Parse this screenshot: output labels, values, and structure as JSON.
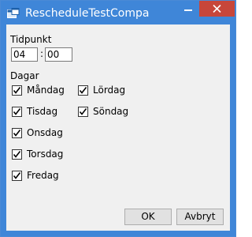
{
  "window": {
    "title": "RescheduleTestCompa",
    "icon": "app-window-icon",
    "colors": {
      "titlebar": "#3f86d8",
      "close": "#c7463a",
      "client": "#f0f0f0"
    }
  },
  "form": {
    "time_label": "Tidpunkt",
    "hour": "04",
    "separator": ":",
    "minute": "00",
    "days_label": "Dagar",
    "days": [
      {
        "label": "Måndag",
        "checked": true
      },
      {
        "label": "Tisdag",
        "checked": true
      },
      {
        "label": "Onsdag",
        "checked": true
      },
      {
        "label": "Torsdag",
        "checked": true
      },
      {
        "label": "Fredag",
        "checked": true
      },
      {
        "label": "Lördag",
        "checked": true
      },
      {
        "label": "Söndag",
        "checked": true
      }
    ]
  },
  "buttons": {
    "ok": "OK",
    "cancel": "Avbryt"
  }
}
